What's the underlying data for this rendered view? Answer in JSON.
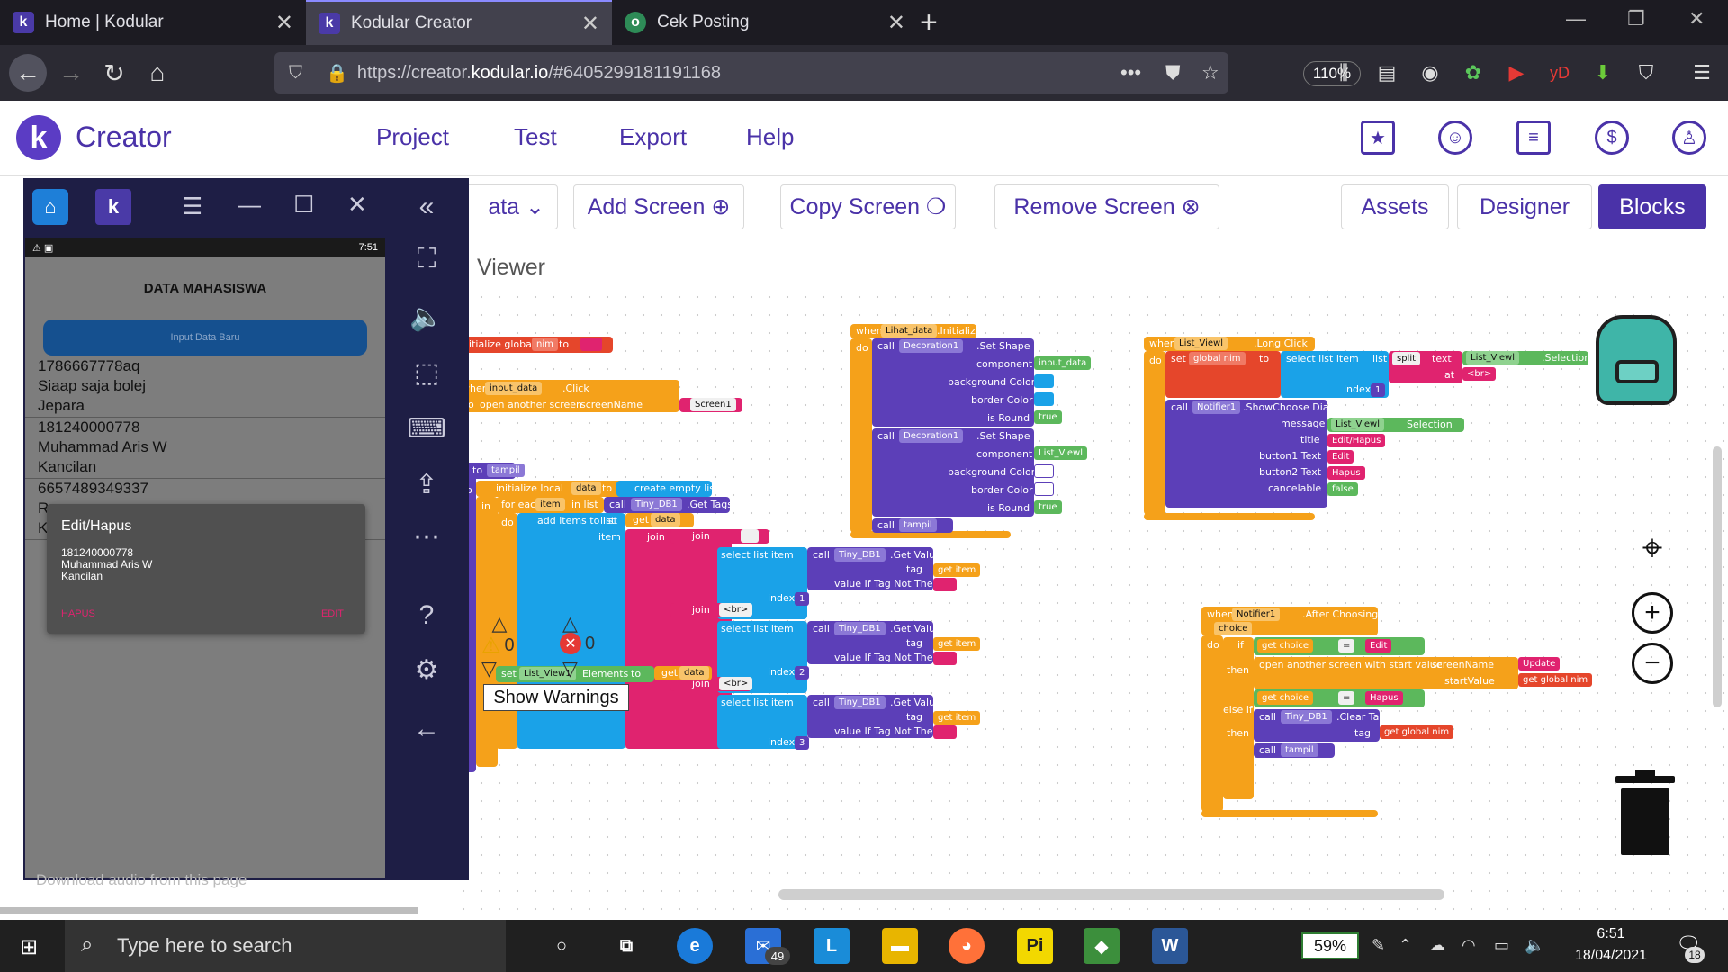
{
  "browser": {
    "tabs": [
      {
        "title": "Home | Kodular",
        "favicon": "k"
      },
      {
        "title": "Kodular Creator",
        "favicon": "k"
      },
      {
        "title": "Cek Posting",
        "favicon": "o"
      }
    ],
    "url_prefix": "https://creator.",
    "url_host": "kodular.io",
    "url_rest": "/#6405299181191168",
    "zoom": "110%"
  },
  "header": {
    "logo_letter": "k",
    "title": "Creator",
    "menu": [
      "Project",
      "Test",
      "Export",
      "Help"
    ]
  },
  "toolbar": {
    "screen_select": "ata",
    "add_screen": "Add Screen",
    "copy_screen": "Copy Screen",
    "remove_screen": "Remove Screen",
    "assets": "Assets",
    "designer": "Designer",
    "blocks": "Blocks",
    "viewer": "Viewer"
  },
  "blocks": {
    "init_global": "initialize global",
    "nim": "nim",
    "to": "to",
    "when": "when",
    "input_data": "input_data",
    "click": ".Click",
    "do": "do",
    "open_another_screen": "open another screen",
    "screenName": "screenName",
    "screen1": "Screen1",
    "proc_to": "to",
    "tampil": "tampil",
    "initialize_local": "initialize local",
    "data": "data",
    "create_empty_list": "create empty list",
    "in": "in",
    "for_each": "for each",
    "item": "item",
    "in_list": "in list",
    "call": "call",
    "tiny_db1": "Tiny_DB1",
    "get_tags": ".Get Tags",
    "add_items_to_list": "add items to list",
    "list": "list",
    "get": "get",
    "join": "join",
    "br": "<br>",
    "select_list_item": "select list item",
    "get_value": ".Get Value",
    "tag": "tag",
    "value_if_tag_not_there": "value If Tag Not There",
    "index": "index",
    "idx1": "1",
    "idx2": "2",
    "idx3": "3",
    "set": "set",
    "list_view1": "List_View1",
    "elements": "Elements",
    "lihat_data": "Lihat_data",
    "initialize": ".Initialize",
    "decoration1": "Decoration1",
    "set_shape": ".Set Shape",
    "component": "component",
    "background_color": "background Color",
    "border_color": "border Color",
    "is_round": "is Round",
    "true": "true",
    "list_viewl": "List_Viewl",
    "long_click": ".Long Click",
    "global_nim": "global nim",
    "split": "split",
    "text": "text",
    "selection": ".Selection",
    "selection_plain": "Selection",
    "at": "at",
    "notifier1": "Notifier1",
    "show_choose_dialog": ".ShowChoose Dialog",
    "message": "message",
    "title": "title",
    "button1_text": "button1 Text",
    "button2_text": "button2 Text",
    "cancelable": "cancelable",
    "edit_hapus": "Edit/Hapus",
    "edit": "Edit",
    "hapus": "Hapus",
    "false": "false",
    "after_choosing": ".After Choosing",
    "choice": "choice",
    "if": "if",
    "eq": "=",
    "then": "then",
    "else_if": "else if",
    "open_with_start": "open another screen with start value",
    "start_value": "startValue",
    "update": "Update",
    "clear_tag": ".Clear Tag"
  },
  "workspace": {
    "warnings": "0",
    "errors": "0",
    "show_warnings": "Show Warnings"
  },
  "emulator": {
    "time": "7:51",
    "page_title": "DATA MAHASISWA",
    "input_button": "Input Data Baru",
    "rows": [
      [
        "1786667778aq",
        "Siaap saja bolej",
        "Jepara"
      ],
      [
        "181240000778",
        "Muhammad Aris W",
        "Kancilan"
      ],
      [
        "6657489349337",
        "R",
        "K"
      ]
    ],
    "dialog_title": "Edit/Hapus",
    "dialog_lines": [
      "181240000778",
      "Muhammad Aris W",
      "Kancilan"
    ],
    "dialog_neg": "HAPUS",
    "dialog_pos": "EDIT",
    "download_hint": "Download audio from this page"
  },
  "taskbar": {
    "search_placeholder": "Type here to search",
    "mail_badge": "49",
    "battery": "59%",
    "time": "6:51",
    "date": "18/04/2021",
    "notif_count": "18"
  },
  "colors": {
    "accent": "#4a32a8",
    "block_purple": "#5c3fb8",
    "block_orange": "#f5a11a",
    "block_pink": "#e0236f",
    "block_cyan": "#1aa2e8",
    "block_red": "#e5462b",
    "block_green": "#5cb85c"
  }
}
